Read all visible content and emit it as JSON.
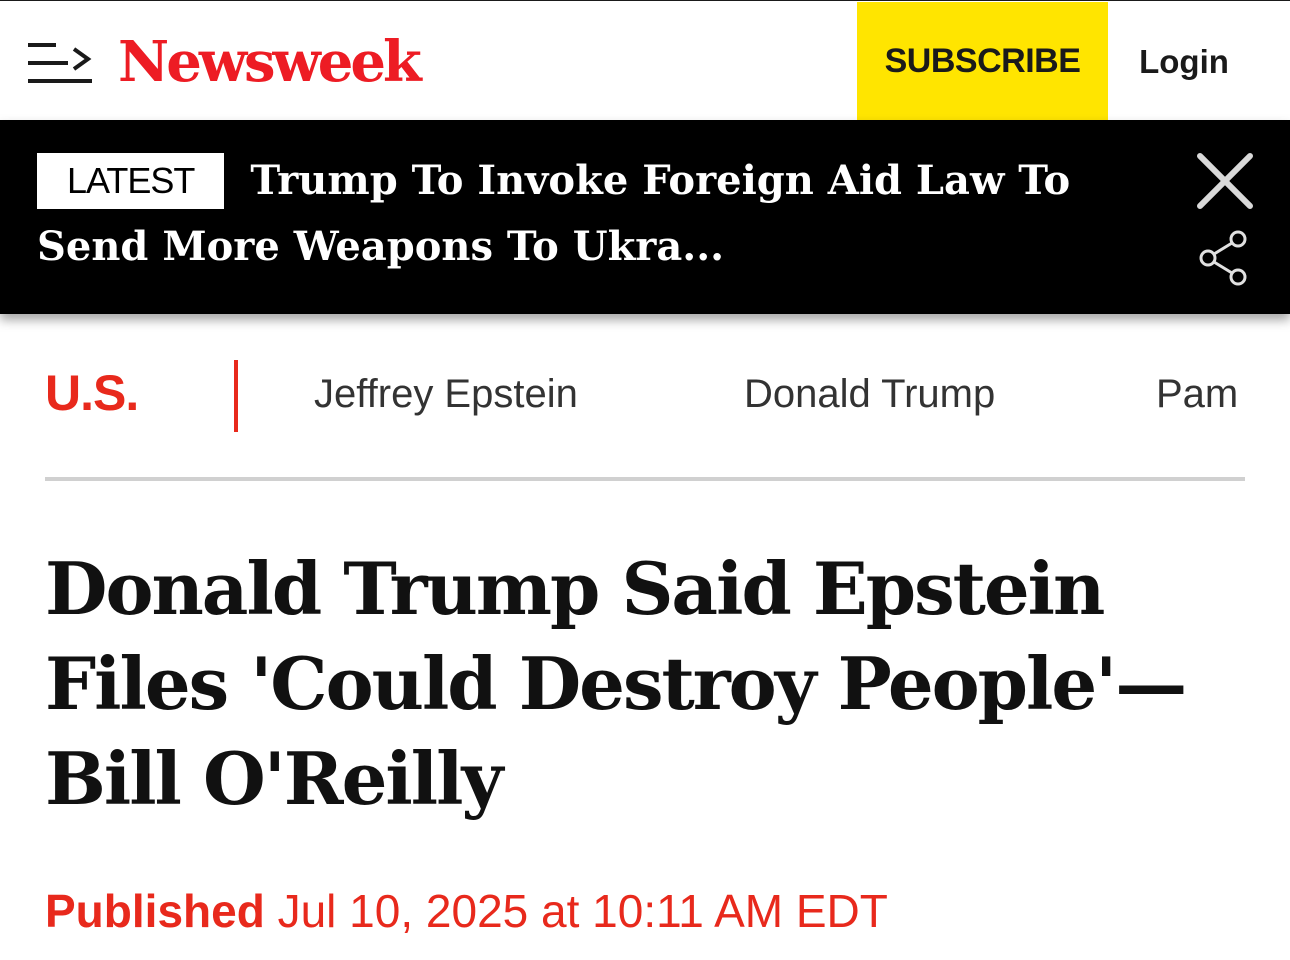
{
  "header": {
    "logo_text": "Newsweek",
    "subscribe_label": "SUBSCRIBE",
    "login_label": "Login"
  },
  "banner": {
    "badge": "LATEST",
    "headline": "Trump To Invoke Foreign Aid Law To Send More Weapons To Ukra..."
  },
  "subnav": {
    "section": "U.S.",
    "topics": [
      "Jeffrey Epstein",
      "Donald Trump",
      "Pam"
    ]
  },
  "article": {
    "headline": "Donald Trump Said Epstein Files 'Could Destroy People'—Bill O'Reilly",
    "published_label": "Published",
    "published_date": "Jul 10, 2025 at 10:11 AM EDT"
  },
  "colors": {
    "brand_red": "#ed1c24",
    "subscribe_yellow": "#ffe500",
    "banner_bg": "#000000"
  },
  "icons": {
    "menu": "menu-arrow-icon",
    "close": "close-icon",
    "share": "share-icon"
  }
}
